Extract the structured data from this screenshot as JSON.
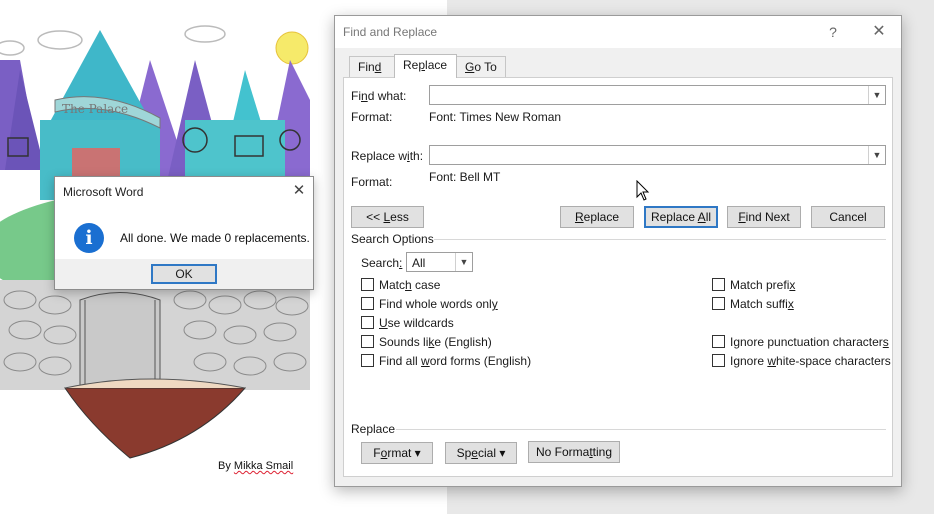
{
  "document": {
    "byline_prefix": "By",
    "byline_name": "Mikka Smail",
    "art_sign": "The Palace"
  },
  "find_replace": {
    "title": "Find and Replace",
    "help_glyph": "?",
    "close_glyph": "✕",
    "tabs": [
      {
        "pre": "Fin",
        "key": "d",
        "post": "",
        "active": false
      },
      {
        "pre": "Re",
        "key": "p",
        "post": "lace",
        "active": true
      },
      {
        "pre": "",
        "key": "G",
        "post": "o To",
        "active": false
      }
    ],
    "find_what": {
      "pre": "Fi",
      "key": "n",
      "post": "d what:",
      "value": ""
    },
    "find_format_label": "Format:",
    "find_format_value": "Font: Times New Roman",
    "replace_with": {
      "pre": "Replace w",
      "key": "i",
      "post": "th:",
      "value": ""
    },
    "replace_format_label": "Format:",
    "replace_format_value": "Font: Bell MT",
    "buttons": {
      "less": {
        "pre": "<< ",
        "key": "L",
        "post": "ess"
      },
      "replace": {
        "pre": "",
        "key": "R",
        "post": "eplace"
      },
      "replace_all": {
        "pre": "Replace ",
        "key": "A",
        "post": "ll"
      },
      "find_next": {
        "pre": "",
        "key": "F",
        "post": "ind Next"
      },
      "cancel": "Cancel"
    },
    "search_options_title": "Search Options",
    "search_label": {
      "pre": "Search",
      "key": ":",
      "post": ""
    },
    "search_value": "All",
    "options_left": [
      {
        "pre": "Matc",
        "key": "h",
        "post": " case",
        "checked": false
      },
      {
        "pre": "Find whole words onl",
        "key": "y",
        "post": "",
        "checked": false
      },
      {
        "pre": "",
        "key": "U",
        "post": "se wildcards",
        "checked": false
      },
      {
        "pre": "Sounds li",
        "key": "k",
        "post": "e (English)",
        "checked": false
      },
      {
        "pre": "Find all ",
        "key": "w",
        "post": "ord forms (English)",
        "checked": false
      }
    ],
    "options_right": [
      {
        "pre": "Match prefi",
        "key": "x",
        "post": "",
        "checked": false
      },
      {
        "pre": "Match suffi",
        "key": "x",
        "post": "",
        "checked": false
      },
      {
        "pre": "Ignore punctuation character",
        "key": "s",
        "post": "",
        "checked": false
      },
      {
        "pre": "Ignore ",
        "key": "w",
        "post": "hite-space characters",
        "checked": false
      }
    ],
    "replace_section_title": "Replace",
    "bottom_buttons": {
      "format": {
        "pre": "F",
        "key": "o",
        "post": "rmat",
        "caret": "▾"
      },
      "special": {
        "pre": "Sp",
        "key": "e",
        "post": "cial",
        "caret": "▾"
      },
      "no_formatting": {
        "pre": "No Forma",
        "key": "t",
        "post": "ting"
      }
    }
  },
  "message_box": {
    "title": "Microsoft Word",
    "close_glyph": "✕",
    "icon_glyph": "i",
    "text": "All done. We made 0 replacements.",
    "ok_label": "OK"
  },
  "colors": {
    "accent_border": "#2f78c5",
    "info_icon": "#1a6fd1"
  }
}
